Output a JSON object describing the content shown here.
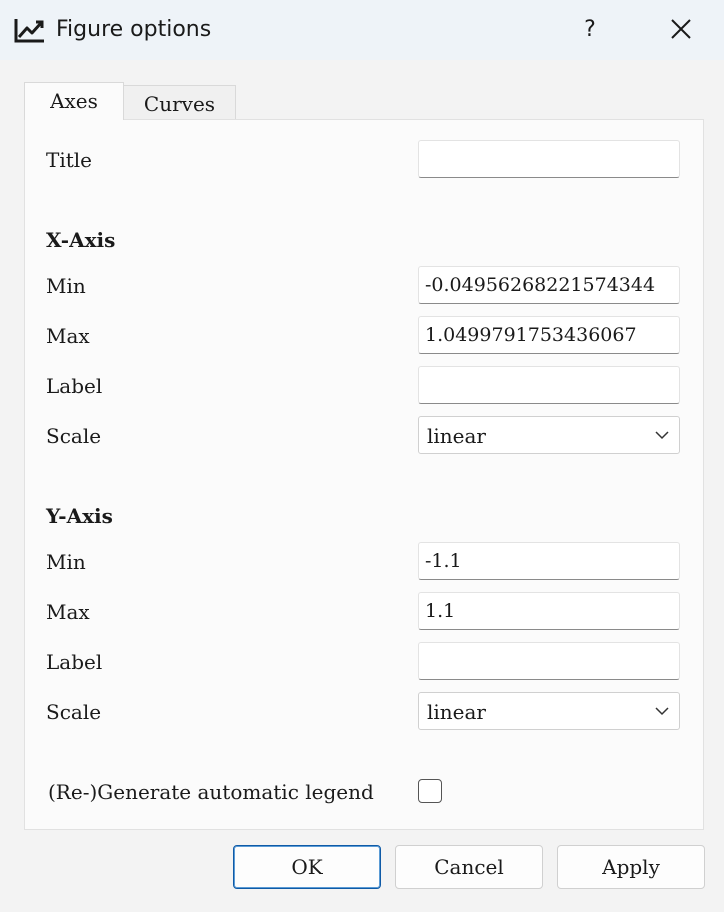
{
  "window": {
    "title": "Figure options",
    "icon": "line-chart-icon",
    "help_label": "?",
    "close_icon": "close-icon"
  },
  "tabs": [
    {
      "label": "Axes",
      "active": true
    },
    {
      "label": "Curves",
      "active": false
    }
  ],
  "axes_tab": {
    "title_label": "Title",
    "title_value": "",
    "x_axis": {
      "heading": "X-Axis",
      "min_label": "Min",
      "min_value": "-0.04956268221574344",
      "max_label": "Max",
      "max_value": "1.0499791753436067",
      "label_label": "Label",
      "label_value": "",
      "scale_label": "Scale",
      "scale_value": "linear"
    },
    "y_axis": {
      "heading": "Y-Axis",
      "min_label": "Min",
      "min_value": "-1.1",
      "max_label": "Max",
      "max_value": "1.1",
      "label_label": "Label",
      "label_value": "",
      "scale_label": "Scale",
      "scale_value": "linear"
    },
    "legend_label": "(Re-)Generate automatic legend",
    "legend_checked": false
  },
  "buttons": {
    "ok": "OK",
    "cancel": "Cancel",
    "apply": "Apply"
  },
  "colors": {
    "titlebar_bg": "#eef3f8",
    "panel_bg": "#fbfbfb",
    "ok_border": "#0f5aa6"
  }
}
